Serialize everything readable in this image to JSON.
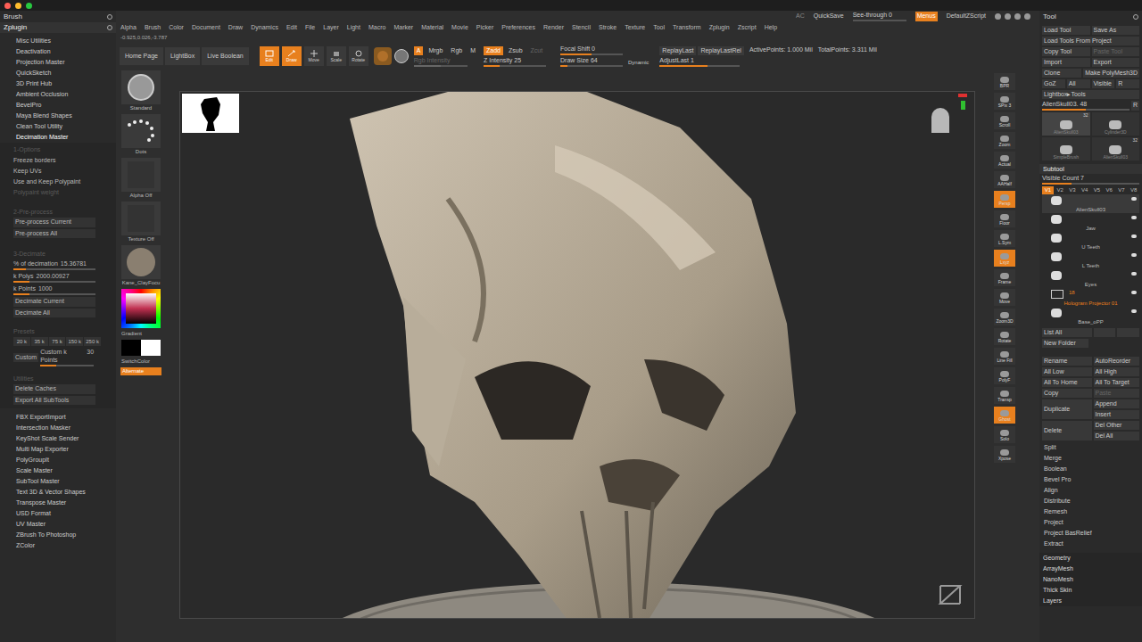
{
  "window": {
    "left_title": "Brush",
    "right_title": "Tool",
    "plugin_menu": "Zplugin"
  },
  "top_right": {
    "ac": "AC",
    "quicksave": "QuickSave",
    "see_through": "See-through",
    "see_through_value": "0",
    "see_through_level": 0.0,
    "menus": "Menus",
    "script": "DefaultZScript"
  },
  "menu": [
    "Alpha",
    "Brush",
    "Color",
    "Document",
    "Draw",
    "Dynamics",
    "Edit",
    "File",
    "Layer",
    "Light",
    "Macro",
    "Marker",
    "Material",
    "Movie",
    "Picker",
    "Preferences",
    "Render",
    "Stencil",
    "Stroke",
    "Texture",
    "Tool",
    "Transform",
    "Zplugin",
    "Zscript",
    "Help"
  ],
  "coords": "-0.925,0.026,-3.787",
  "toolbar": {
    "nav": [
      "Home Page",
      "LightBox",
      "Live Boolean"
    ],
    "modes": [
      {
        "label": "Edit",
        "selected": true
      },
      {
        "label": "Draw",
        "selected": true
      },
      {
        "label": "Move",
        "selected": false
      },
      {
        "label": "Scale",
        "selected": false
      },
      {
        "label": "Rotate",
        "selected": false
      }
    ],
    "channels": [
      {
        "label": "A",
        "selected": true
      },
      {
        "label": "Mrgb",
        "selected": false
      },
      {
        "label": "Rgb",
        "selected": false
      },
      {
        "label": "M",
        "selected": false
      }
    ],
    "zmodes": [
      {
        "label": "Zadd",
        "selected": true,
        "disabled": false
      },
      {
        "label": "Zsub",
        "selected": false,
        "disabled": false
      },
      {
        "label": "Zcut",
        "selected": false,
        "disabled": true
      }
    ],
    "rgb_intensity": {
      "label": "Rgb Intensity",
      "level": 0.5,
      "disabled": true
    },
    "z_intensity": {
      "label": "Z Intensity",
      "value": "25",
      "level": 0.25
    },
    "focal_shift": {
      "label": "Focal Shift",
      "value": "0",
      "level": 0.5
    },
    "draw_size": {
      "label": "Draw Size",
      "value": "64",
      "level": 0.12
    },
    "dynamic": "Dynamic",
    "replay": [
      "ReplayLast",
      "ReplayLastRel"
    ],
    "adjust_last": {
      "label": "AdjustLast",
      "value": "1",
      "level": 0.6
    },
    "active_points": "ActivePoints: 1.000 Mil",
    "total_points": "TotalPoints: 3.311 Mil"
  },
  "plugins_top": [
    {
      "label": "Misc Utilities",
      "expanded": false
    },
    {
      "label": "Deactivation",
      "expanded": false
    },
    {
      "label": "Projection Master",
      "expanded": false
    },
    {
      "label": "QuickSketch",
      "expanded": false
    },
    {
      "label": "3D Print Hub",
      "expanded": false
    },
    {
      "label": "Ambient Occlusion",
      "expanded": false
    },
    {
      "label": "BevelPro",
      "expanded": false
    },
    {
      "label": "Maya Blend Shapes",
      "expanded": false
    },
    {
      "label": "Clean Tool Utility",
      "expanded": false
    },
    {
      "label": "Decimation Master",
      "expanded": true
    }
  ],
  "decimation": {
    "options_title": "1-Options",
    "options": [
      {
        "label": "Freeze borders",
        "disabled": false
      },
      {
        "label": "Keep UVs",
        "disabled": false
      },
      {
        "label": "Use and Keep Polypaint",
        "disabled": false
      },
      {
        "label": "Polypaint weight",
        "disabled": true
      }
    ],
    "preprocess_title": "2-Pre-process",
    "preprocess": [
      "Pre-process Current",
      "Pre-process All"
    ],
    "decimate_title": "3-Decimate",
    "sliders": [
      {
        "label": "% of decimation",
        "value": "15.36781",
        "level": 0.15
      },
      {
        "label": "k Polys",
        "value": "2000.00927",
        "level": 0.2
      },
      {
        "label": "k Points",
        "value": "1000",
        "level": 0.2
      }
    ],
    "decimate": [
      "Decimate Current",
      "Decimate All"
    ],
    "presets_title": "Presets",
    "presets": [
      "20 k",
      "35 k",
      "75 k",
      "150 k",
      "250 k"
    ],
    "custom": "Custom",
    "custom_slider": {
      "label": "Custom k Points",
      "value": "30",
      "level": 0.3
    },
    "utilities_title": "Utilities",
    "utilities": [
      "Delete Caches",
      "Export All SubTools"
    ]
  },
  "plugins_bottom": [
    "FBX ExportImport",
    "Intersection Masker",
    "KeyShot Scale Sender",
    "Multi Map Exporter",
    "PolyGroupIt",
    "Scale Master",
    "SubTool Master",
    "Text 3D & Vector Shapes",
    "Transpose Master",
    "USD Format",
    "UV Master",
    "ZBrush To Photoshop",
    "ZColor"
  ],
  "left_shelf": {
    "brush": "Standard",
    "stroke": "Dots",
    "alpha": "Alpha Off",
    "texture": "Texture Off",
    "material": "Kane_ClayFocu",
    "gradient": "Gradient",
    "switch_color": "SwitchColor",
    "alternate": "Alternate"
  },
  "right_shelf": [
    {
      "label": "BPR",
      "selected": false
    },
    {
      "label": "SPix 3",
      "selected": false
    },
    {
      "label": "Scroll",
      "selected": false
    },
    {
      "label": "Zoom",
      "selected": false
    },
    {
      "label": "Actual",
      "selected": false
    },
    {
      "label": "AAHalf",
      "selected": false
    },
    {
      "label": "Persp",
      "selected": true
    },
    {
      "label": "Floor",
      "selected": false
    },
    {
      "label": "L.Sym",
      "selected": false
    },
    {
      "label": "Lxyz",
      "selected": true
    },
    {
      "label": "Frame",
      "selected": false
    },
    {
      "label": "Move",
      "selected": false
    },
    {
      "label": "Zoom3D",
      "selected": false
    },
    {
      "label": "Rotate",
      "selected": false
    },
    {
      "label": "Line Fill",
      "selected": false
    },
    {
      "label": "PolyF",
      "selected": false
    },
    {
      "label": "Transp",
      "selected": false
    },
    {
      "label": "Ghost",
      "selected": true
    },
    {
      "label": "Solo",
      "selected": false
    },
    {
      "label": "Xpose",
      "selected": false
    }
  ],
  "tool": {
    "rows": [
      [
        {
          "label": "Load Tool",
          "disabled": false
        },
        {
          "label": "Save As",
          "disabled": false
        }
      ],
      [
        {
          "label": "Load Tools From Project",
          "disabled": false
        }
      ],
      [
        {
          "label": "Copy Tool",
          "disabled": false
        },
        {
          "label": "Paste Tool",
          "disabled": true
        }
      ],
      [
        {
          "label": "Import",
          "disabled": false
        },
        {
          "label": "Export",
          "disabled": false
        }
      ],
      [
        {
          "label": "Clone",
          "disabled": false
        },
        {
          "label": "Make PolyMesh3D",
          "disabled": false
        }
      ],
      [
        {
          "label": "GoZ",
          "disabled": false
        },
        {
          "label": "All",
          "disabled": false
        },
        {
          "label": "Visible",
          "disabled": false
        },
        {
          "label": "R",
          "disabled": false
        }
      ],
      [
        {
          "label": "Lightbox▸Tools",
          "disabled": false
        }
      ]
    ],
    "current": {
      "label": "AlienSkull03. 48",
      "level": 0.5,
      "r": "R"
    },
    "thumbs": [
      {
        "label": "AlienSkull03",
        "count": "32",
        "selected": true
      },
      {
        "label": "Cylinder3D",
        "count": "",
        "selected": false
      },
      {
        "label": "SimpleBrush",
        "count": "",
        "selected": false
      },
      {
        "label": "AlienSkull03",
        "count": "32",
        "selected": false
      }
    ],
    "subtool_title": "Subtool",
    "visible_count": {
      "label": "Visible Count",
      "value": "7"
    },
    "versions": [
      {
        "label": "V1",
        "selected": true
      },
      {
        "label": "V2",
        "selected": false
      },
      {
        "label": "V3",
        "selected": false
      },
      {
        "label": "V4",
        "selected": false
      },
      {
        "label": "V5",
        "selected": false
      },
      {
        "label": "V6",
        "selected": false
      },
      {
        "label": "V7",
        "selected": false
      },
      {
        "label": "V8",
        "selected": false
      }
    ],
    "subtools": [
      {
        "kind": "subtool",
        "name": "AlienSkull03",
        "count": "",
        "selected": true
      },
      {
        "kind": "subtool",
        "name": "Jaw",
        "count": "",
        "selected": false
      },
      {
        "kind": "subtool",
        "name": "U Teeth",
        "count": "",
        "selected": false
      },
      {
        "kind": "subtool",
        "name": "L Teeth",
        "count": "",
        "selected": false
      },
      {
        "kind": "subtool",
        "name": "Eyes",
        "count": "",
        "selected": false
      },
      {
        "kind": "folder",
        "name": "Hologram Projector 01",
        "count": "18",
        "selected": false
      },
      {
        "kind": "subtool",
        "name": "Base_oPP",
        "count": "",
        "selected": false
      }
    ],
    "list_all": "List All",
    "new_folder": "New Folder",
    "actions": [
      {
        "left": "Rename",
        "right": [
          {
            "label": "AutoReorder",
            "disabled": false
          }
        ]
      },
      {
        "left": "All Low",
        "right": [
          {
            "label": "All High",
            "disabled": false
          }
        ]
      },
      {
        "left": "All To Home",
        "right": [
          {
            "label": "All To Target",
            "disabled": false
          }
        ]
      },
      {
        "left": "Copy",
        "right": [
          {
            "label": "Paste",
            "disabled": true
          }
        ]
      },
      {
        "left": "Duplicate",
        "right": [
          {
            "label": "Append",
            "disabled": false
          },
          {
            "label": "Insert",
            "disabled": false
          }
        ]
      },
      {
        "left": "Delete",
        "right": [
          {
            "label": "Del Other",
            "disabled": false
          },
          {
            "label": "Del All",
            "disabled": false
          }
        ]
      }
    ],
    "sub_menus": [
      "Split",
      "Merge",
      "Boolean",
      "Bevel Pro",
      "Align",
      "Distribute",
      "Remesh",
      "Project",
      "Project BasRelief",
      "Extract"
    ],
    "menus": [
      "Geometry",
      "ArrayMesh",
      "NanoMesh",
      "Thick Skin",
      "Layers"
    ]
  }
}
